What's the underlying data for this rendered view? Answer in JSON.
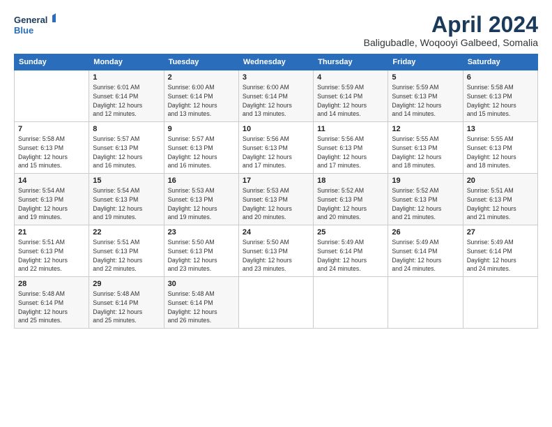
{
  "logo": {
    "line1": "General",
    "line2": "Blue"
  },
  "title": "April 2024",
  "subtitle": "Baligubadle, Woqooyi Galbeed, Somalia",
  "header": {
    "days": [
      "Sunday",
      "Monday",
      "Tuesday",
      "Wednesday",
      "Thursday",
      "Friday",
      "Saturday"
    ]
  },
  "weeks": [
    [
      {
        "num": "",
        "info": ""
      },
      {
        "num": "1",
        "info": "Sunrise: 6:01 AM\nSunset: 6:14 PM\nDaylight: 12 hours\nand 12 minutes."
      },
      {
        "num": "2",
        "info": "Sunrise: 6:00 AM\nSunset: 6:14 PM\nDaylight: 12 hours\nand 13 minutes."
      },
      {
        "num": "3",
        "info": "Sunrise: 6:00 AM\nSunset: 6:14 PM\nDaylight: 12 hours\nand 13 minutes."
      },
      {
        "num": "4",
        "info": "Sunrise: 5:59 AM\nSunset: 6:14 PM\nDaylight: 12 hours\nand 14 minutes."
      },
      {
        "num": "5",
        "info": "Sunrise: 5:59 AM\nSunset: 6:13 PM\nDaylight: 12 hours\nand 14 minutes."
      },
      {
        "num": "6",
        "info": "Sunrise: 5:58 AM\nSunset: 6:13 PM\nDaylight: 12 hours\nand 15 minutes."
      }
    ],
    [
      {
        "num": "7",
        "info": "Sunrise: 5:58 AM\nSunset: 6:13 PM\nDaylight: 12 hours\nand 15 minutes."
      },
      {
        "num": "8",
        "info": "Sunrise: 5:57 AM\nSunset: 6:13 PM\nDaylight: 12 hours\nand 16 minutes."
      },
      {
        "num": "9",
        "info": "Sunrise: 5:57 AM\nSunset: 6:13 PM\nDaylight: 12 hours\nand 16 minutes."
      },
      {
        "num": "10",
        "info": "Sunrise: 5:56 AM\nSunset: 6:13 PM\nDaylight: 12 hours\nand 17 minutes."
      },
      {
        "num": "11",
        "info": "Sunrise: 5:56 AM\nSunset: 6:13 PM\nDaylight: 12 hours\nand 17 minutes."
      },
      {
        "num": "12",
        "info": "Sunrise: 5:55 AM\nSunset: 6:13 PM\nDaylight: 12 hours\nand 18 minutes."
      },
      {
        "num": "13",
        "info": "Sunrise: 5:55 AM\nSunset: 6:13 PM\nDaylight: 12 hours\nand 18 minutes."
      }
    ],
    [
      {
        "num": "14",
        "info": "Sunrise: 5:54 AM\nSunset: 6:13 PM\nDaylight: 12 hours\nand 19 minutes."
      },
      {
        "num": "15",
        "info": "Sunrise: 5:54 AM\nSunset: 6:13 PM\nDaylight: 12 hours\nand 19 minutes."
      },
      {
        "num": "16",
        "info": "Sunrise: 5:53 AM\nSunset: 6:13 PM\nDaylight: 12 hours\nand 19 minutes."
      },
      {
        "num": "17",
        "info": "Sunrise: 5:53 AM\nSunset: 6:13 PM\nDaylight: 12 hours\nand 20 minutes."
      },
      {
        "num": "18",
        "info": "Sunrise: 5:52 AM\nSunset: 6:13 PM\nDaylight: 12 hours\nand 20 minutes."
      },
      {
        "num": "19",
        "info": "Sunrise: 5:52 AM\nSunset: 6:13 PM\nDaylight: 12 hours\nand 21 minutes."
      },
      {
        "num": "20",
        "info": "Sunrise: 5:51 AM\nSunset: 6:13 PM\nDaylight: 12 hours\nand 21 minutes."
      }
    ],
    [
      {
        "num": "21",
        "info": "Sunrise: 5:51 AM\nSunset: 6:13 PM\nDaylight: 12 hours\nand 22 minutes."
      },
      {
        "num": "22",
        "info": "Sunrise: 5:51 AM\nSunset: 6:13 PM\nDaylight: 12 hours\nand 22 minutes."
      },
      {
        "num": "23",
        "info": "Sunrise: 5:50 AM\nSunset: 6:13 PM\nDaylight: 12 hours\nand 23 minutes."
      },
      {
        "num": "24",
        "info": "Sunrise: 5:50 AM\nSunset: 6:13 PM\nDaylight: 12 hours\nand 23 minutes."
      },
      {
        "num": "25",
        "info": "Sunrise: 5:49 AM\nSunset: 6:14 PM\nDaylight: 12 hours\nand 24 minutes."
      },
      {
        "num": "26",
        "info": "Sunrise: 5:49 AM\nSunset: 6:14 PM\nDaylight: 12 hours\nand 24 minutes."
      },
      {
        "num": "27",
        "info": "Sunrise: 5:49 AM\nSunset: 6:14 PM\nDaylight: 12 hours\nand 24 minutes."
      }
    ],
    [
      {
        "num": "28",
        "info": "Sunrise: 5:48 AM\nSunset: 6:14 PM\nDaylight: 12 hours\nand 25 minutes."
      },
      {
        "num": "29",
        "info": "Sunrise: 5:48 AM\nSunset: 6:14 PM\nDaylight: 12 hours\nand 25 minutes."
      },
      {
        "num": "30",
        "info": "Sunrise: 5:48 AM\nSunset: 6:14 PM\nDaylight: 12 hours\nand 26 minutes."
      },
      {
        "num": "",
        "info": ""
      },
      {
        "num": "",
        "info": ""
      },
      {
        "num": "",
        "info": ""
      },
      {
        "num": "",
        "info": ""
      }
    ]
  ]
}
